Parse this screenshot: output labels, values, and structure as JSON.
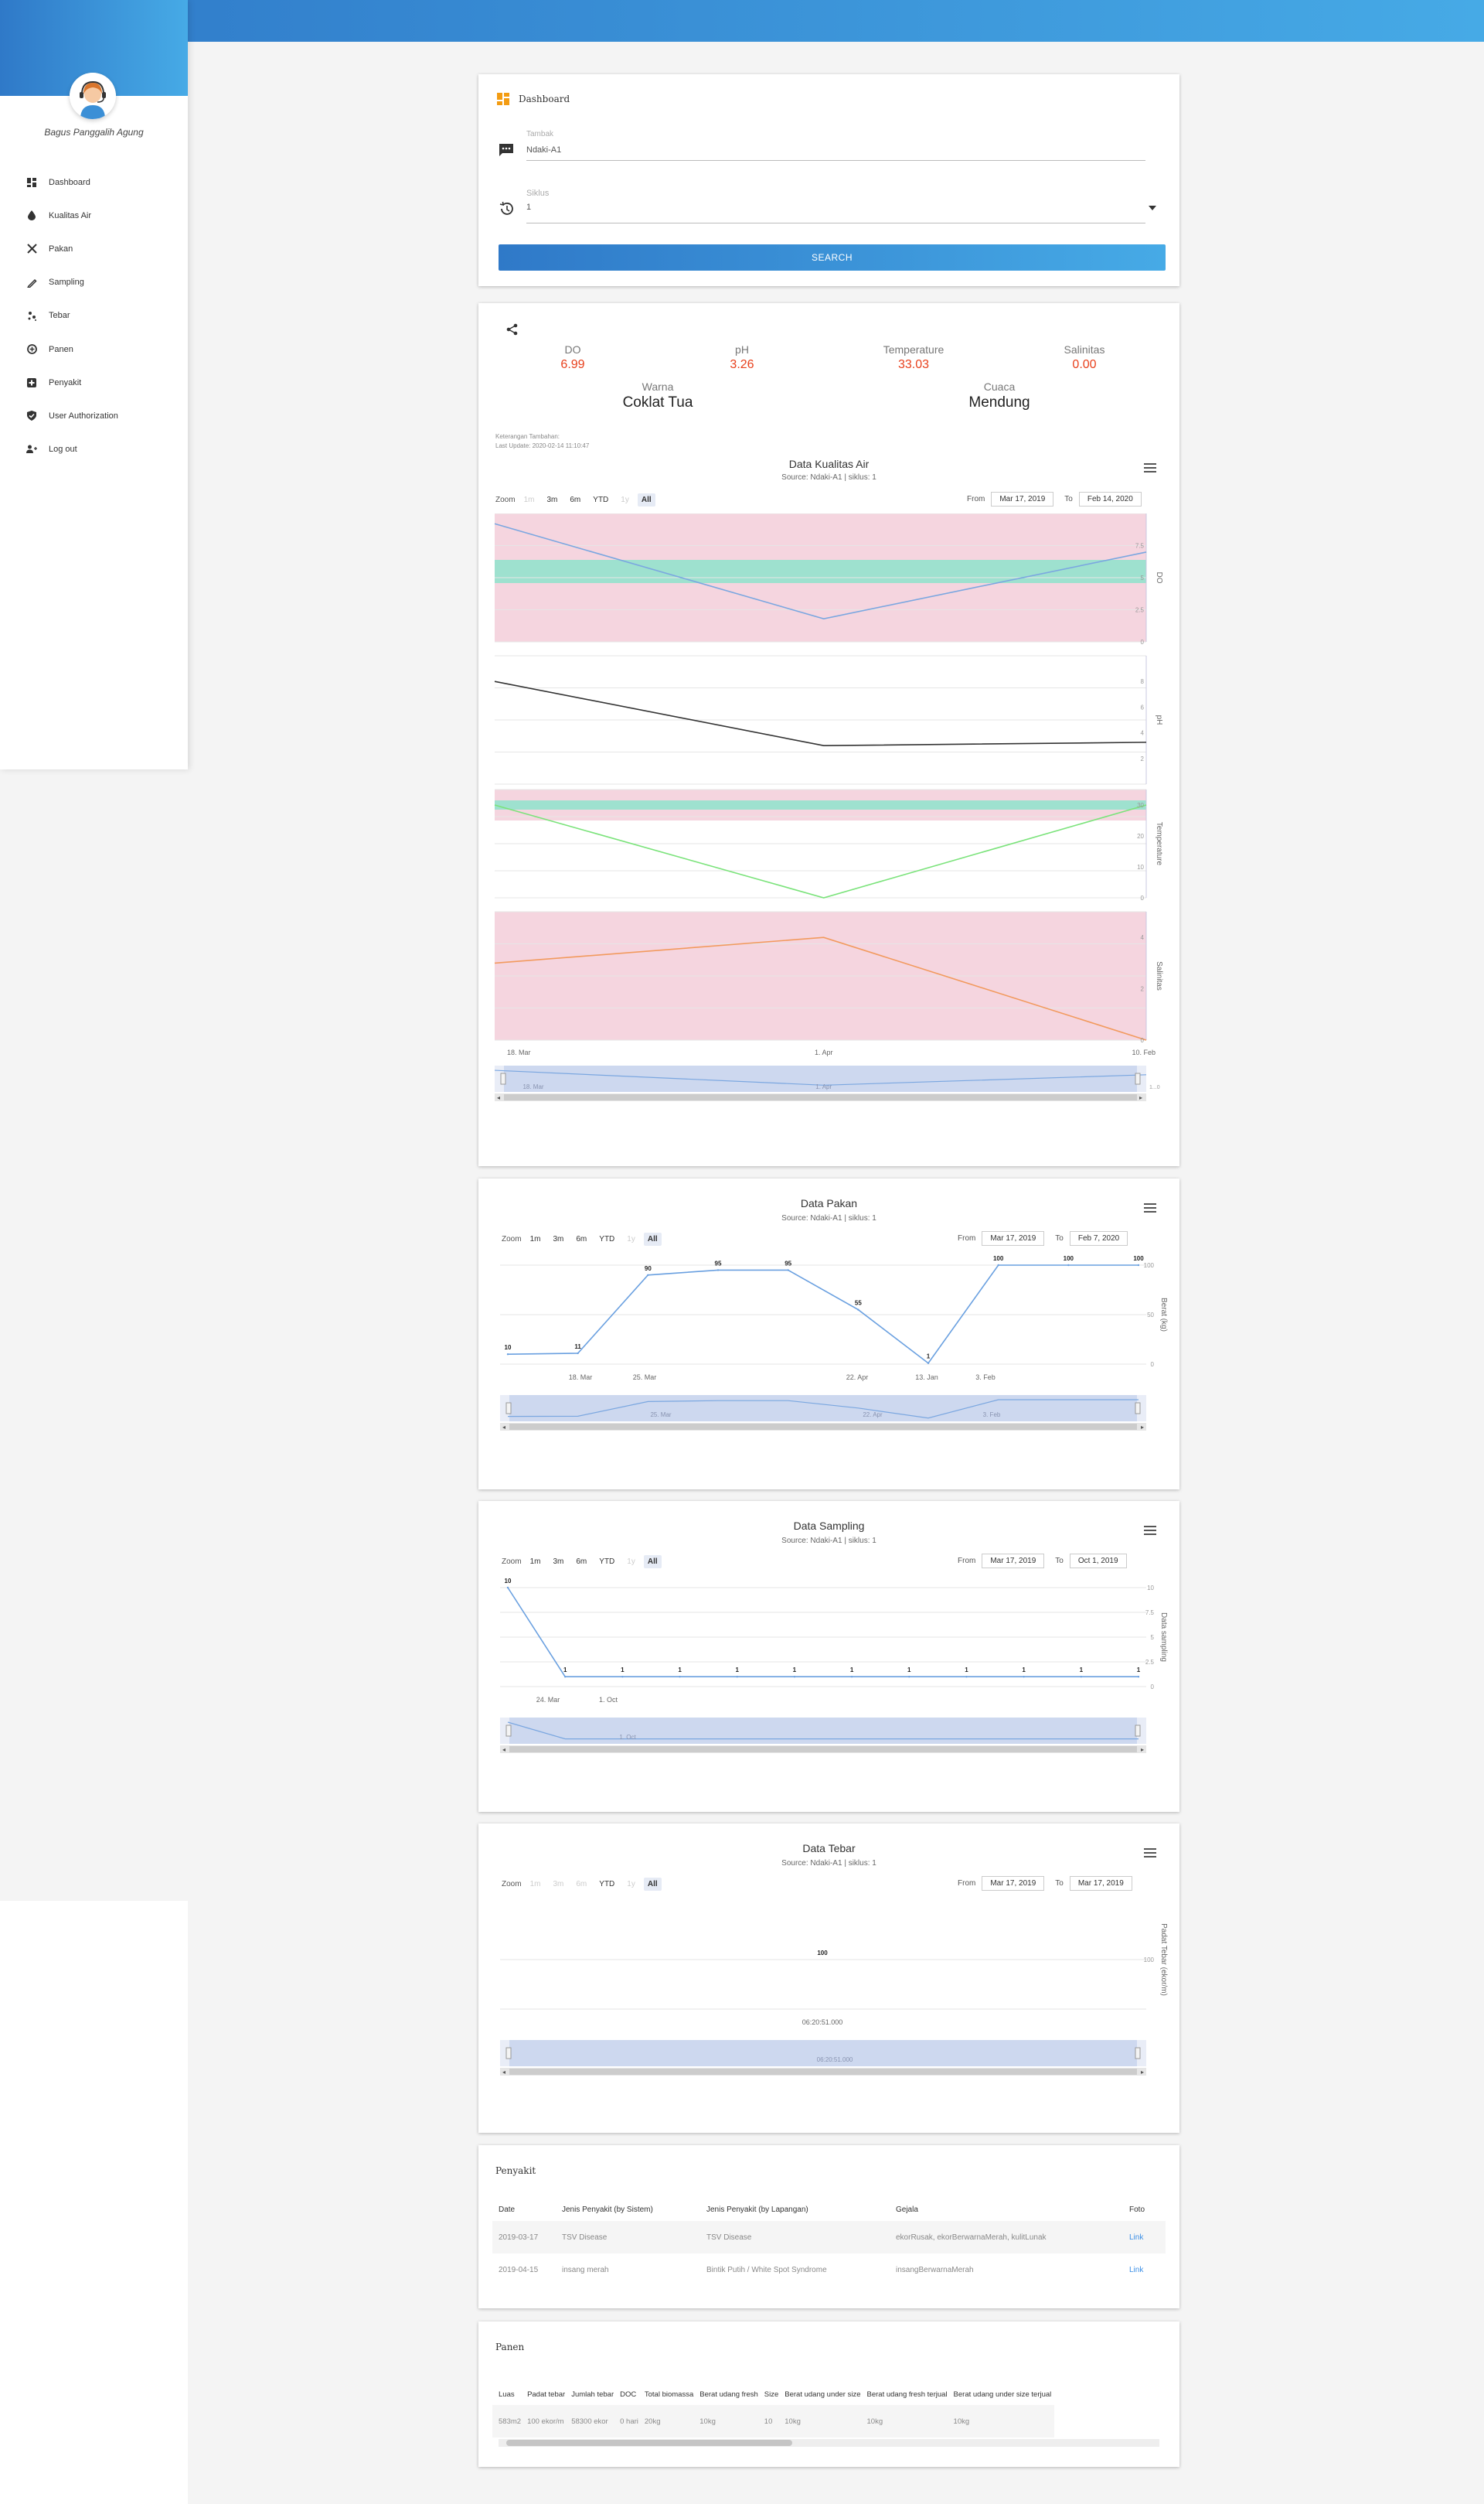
{
  "user": {
    "name": "Bagus Panggalih Agung"
  },
  "sidebar": {
    "items": [
      {
        "label": "Dashboard",
        "icon": "dashboard-icon"
      },
      {
        "label": "Kualitas Air",
        "icon": "water-drop-icon"
      },
      {
        "label": "Pakan",
        "icon": "utensils-icon"
      },
      {
        "label": "Sampling",
        "icon": "pen-icon"
      },
      {
        "label": "Tebar",
        "icon": "scatter-icon"
      },
      {
        "label": "Panen",
        "icon": "harvest-icon"
      },
      {
        "label": "Penyakit",
        "icon": "medical-plus-icon"
      },
      {
        "label": "User Authorization",
        "icon": "shield-check-icon"
      },
      {
        "label": "Log out",
        "icon": "users-logout-icon"
      }
    ]
  },
  "search": {
    "title": "Dashboard",
    "tambak_label": "Tambak",
    "tambak_value": "Ndaki-A1",
    "siklus_label": "Siklus",
    "siklus_value": "1",
    "button": "SEARCH"
  },
  "summary": {
    "do_label": "DO",
    "do_value": "6.99",
    "ph_label": "pH",
    "ph_value": "3.26",
    "temp_label": "Temperature",
    "temp_value": "33.03",
    "sal_label": "Salinitas",
    "sal_value": "0.00",
    "warna_label": "Warna",
    "warna_value": "Coklat Tua",
    "cuaca_label": "Cuaca",
    "cuaca_value": "Mendung",
    "ket": "Keterangan Tambahan:",
    "last_update": "Last Update: 2020-02-14 11:10:47"
  },
  "zoom": {
    "label": "Zoom",
    "b1m": "1m",
    "b3m": "3m",
    "b6m": "6m",
    "bytd": "YTD",
    "b1y": "1y",
    "ball": "All",
    "from": "From",
    "to": "To"
  },
  "colors": {
    "accent": "#3a8ee6",
    "stat_value": "#e8401c",
    "band_pink": "#f5d5df",
    "band_green": "#8ee3cc"
  },
  "chart_data": [
    {
      "type": "line",
      "title": "Data Kualitas Air",
      "subtitle": "Source: Ndaki-A1 | siklus: 1",
      "from": "Mar 17, 2019",
      "to": "Feb 14, 2020",
      "x": [
        "18. Mar",
        "1. Apr",
        "10. Feb"
      ],
      "navigator_labels": [
        "18. Mar",
        "1. Apr"
      ],
      "navigator_value": "1...0",
      "series": [
        {
          "name": "DO",
          "values": [
            9.2,
            1.8,
            6.99
          ],
          "color": "#7ba7e0",
          "yticks": [
            "0",
            "2.5",
            "5",
            "7.5"
          ],
          "ylim": [
            0,
            10
          ]
        },
        {
          "name": "pH",
          "values": [
            8.0,
            3.0,
            3.26
          ],
          "color": "#333333",
          "yticks": [
            "2",
            "4",
            "6",
            "8"
          ],
          "ylim": [
            0,
            10
          ]
        },
        {
          "name": "Temperature",
          "values": [
            30,
            0,
            30
          ],
          "color": "#7be37b",
          "yticks": [
            "0",
            "10",
            "20",
            "30"
          ],
          "ylim": [
            0,
            35
          ]
        },
        {
          "name": "Salinitas",
          "values": [
            3,
            4,
            0
          ],
          "color": "#f29a5e",
          "yticks": [
            "0",
            "2",
            "4"
          ],
          "ylim": [
            0,
            5
          ]
        }
      ]
    },
    {
      "type": "line",
      "title": "Data Pakan",
      "subtitle": "Source: Ndaki-A1 | siklus: 1",
      "from": "Mar 17, 2019",
      "to": "Feb 7, 2020",
      "ylabel": "Berat (kg)",
      "yticks": [
        "0",
        "50",
        "100"
      ],
      "ylim": [
        0,
        100
      ],
      "xticks": [
        "18. Mar",
        "25. Mar",
        "22. Apr",
        "13. Jan",
        "3. Feb"
      ],
      "navigator_labels": [
        "25. Mar",
        "22. Apr",
        "3. Feb"
      ],
      "values": [
        10,
        11,
        90,
        95,
        95,
        55,
        1,
        100,
        100,
        100
      ],
      "data_labels": [
        "10",
        "11",
        "90",
        "95",
        "95",
        "55",
        "1",
        "100",
        "100",
        "100"
      ]
    },
    {
      "type": "line",
      "title": "Data Sampling",
      "subtitle": "Source: Ndaki-A1 | siklus: 1",
      "from": "Mar 17, 2019",
      "to": "Oct 1, 2019",
      "ylabel": "Data sampling",
      "yticks": [
        "0",
        "2.5",
        "5",
        "7.5",
        "10"
      ],
      "ylim": [
        0,
        10
      ],
      "xticks": [
        "24. Mar",
        "1. Oct"
      ],
      "navigator_labels": [
        "1. Oct"
      ],
      "values": [
        10,
        1,
        1,
        1,
        1,
        1,
        1,
        1,
        1,
        1,
        1,
        1
      ],
      "data_labels": [
        "10",
        "1",
        "1",
        "1",
        "1",
        "1",
        "1",
        "1",
        "1",
        "1",
        "1",
        "1"
      ]
    },
    {
      "type": "line",
      "title": "Data Tebar",
      "subtitle": "Source: Ndaki-A1 | siklus: 1",
      "from": "Mar 17, 2019",
      "to": "Mar 17, 2019",
      "ylabel": "Padat Tebar (ekor/m)",
      "yticks": [
        "100"
      ],
      "xticks": [
        "06:20:51.000"
      ],
      "navigator_labels": [
        "06:20:51.000"
      ],
      "values": [
        100
      ],
      "data_labels": [
        "100"
      ]
    }
  ],
  "penyakit": {
    "title": "Penyakit",
    "headers": [
      "Date",
      "Jenis Penyakit (by Sistem)",
      "Jenis Penyakit (by Lapangan)",
      "Gejala",
      "Foto"
    ],
    "rows": [
      [
        "2019-03-17",
        "TSV Disease",
        "TSV Disease",
        "ekorRusak, ekorBerwarnaMerah, kulitLunak",
        "Link"
      ],
      [
        "2019-04-15",
        "insang merah",
        "Bintik Putih / White Spot Syndrome",
        "insangBerwarnaMerah",
        "Link"
      ]
    ]
  },
  "panen": {
    "title": "Panen",
    "headers": [
      "Luas",
      "Padat tebar",
      "Jumlah tebar",
      "DOC",
      "Total biomassa",
      "Berat udang fresh",
      "Size",
      "Berat udang under size",
      "Berat udang fresh terjual",
      "Berat udang under size terjual"
    ],
    "rows": [
      [
        "583m2",
        "100 ekor/m",
        "58300 ekor",
        "0 hari",
        "20kg",
        "10kg",
        "10",
        "10kg",
        "10kg",
        "10kg"
      ]
    ]
  }
}
